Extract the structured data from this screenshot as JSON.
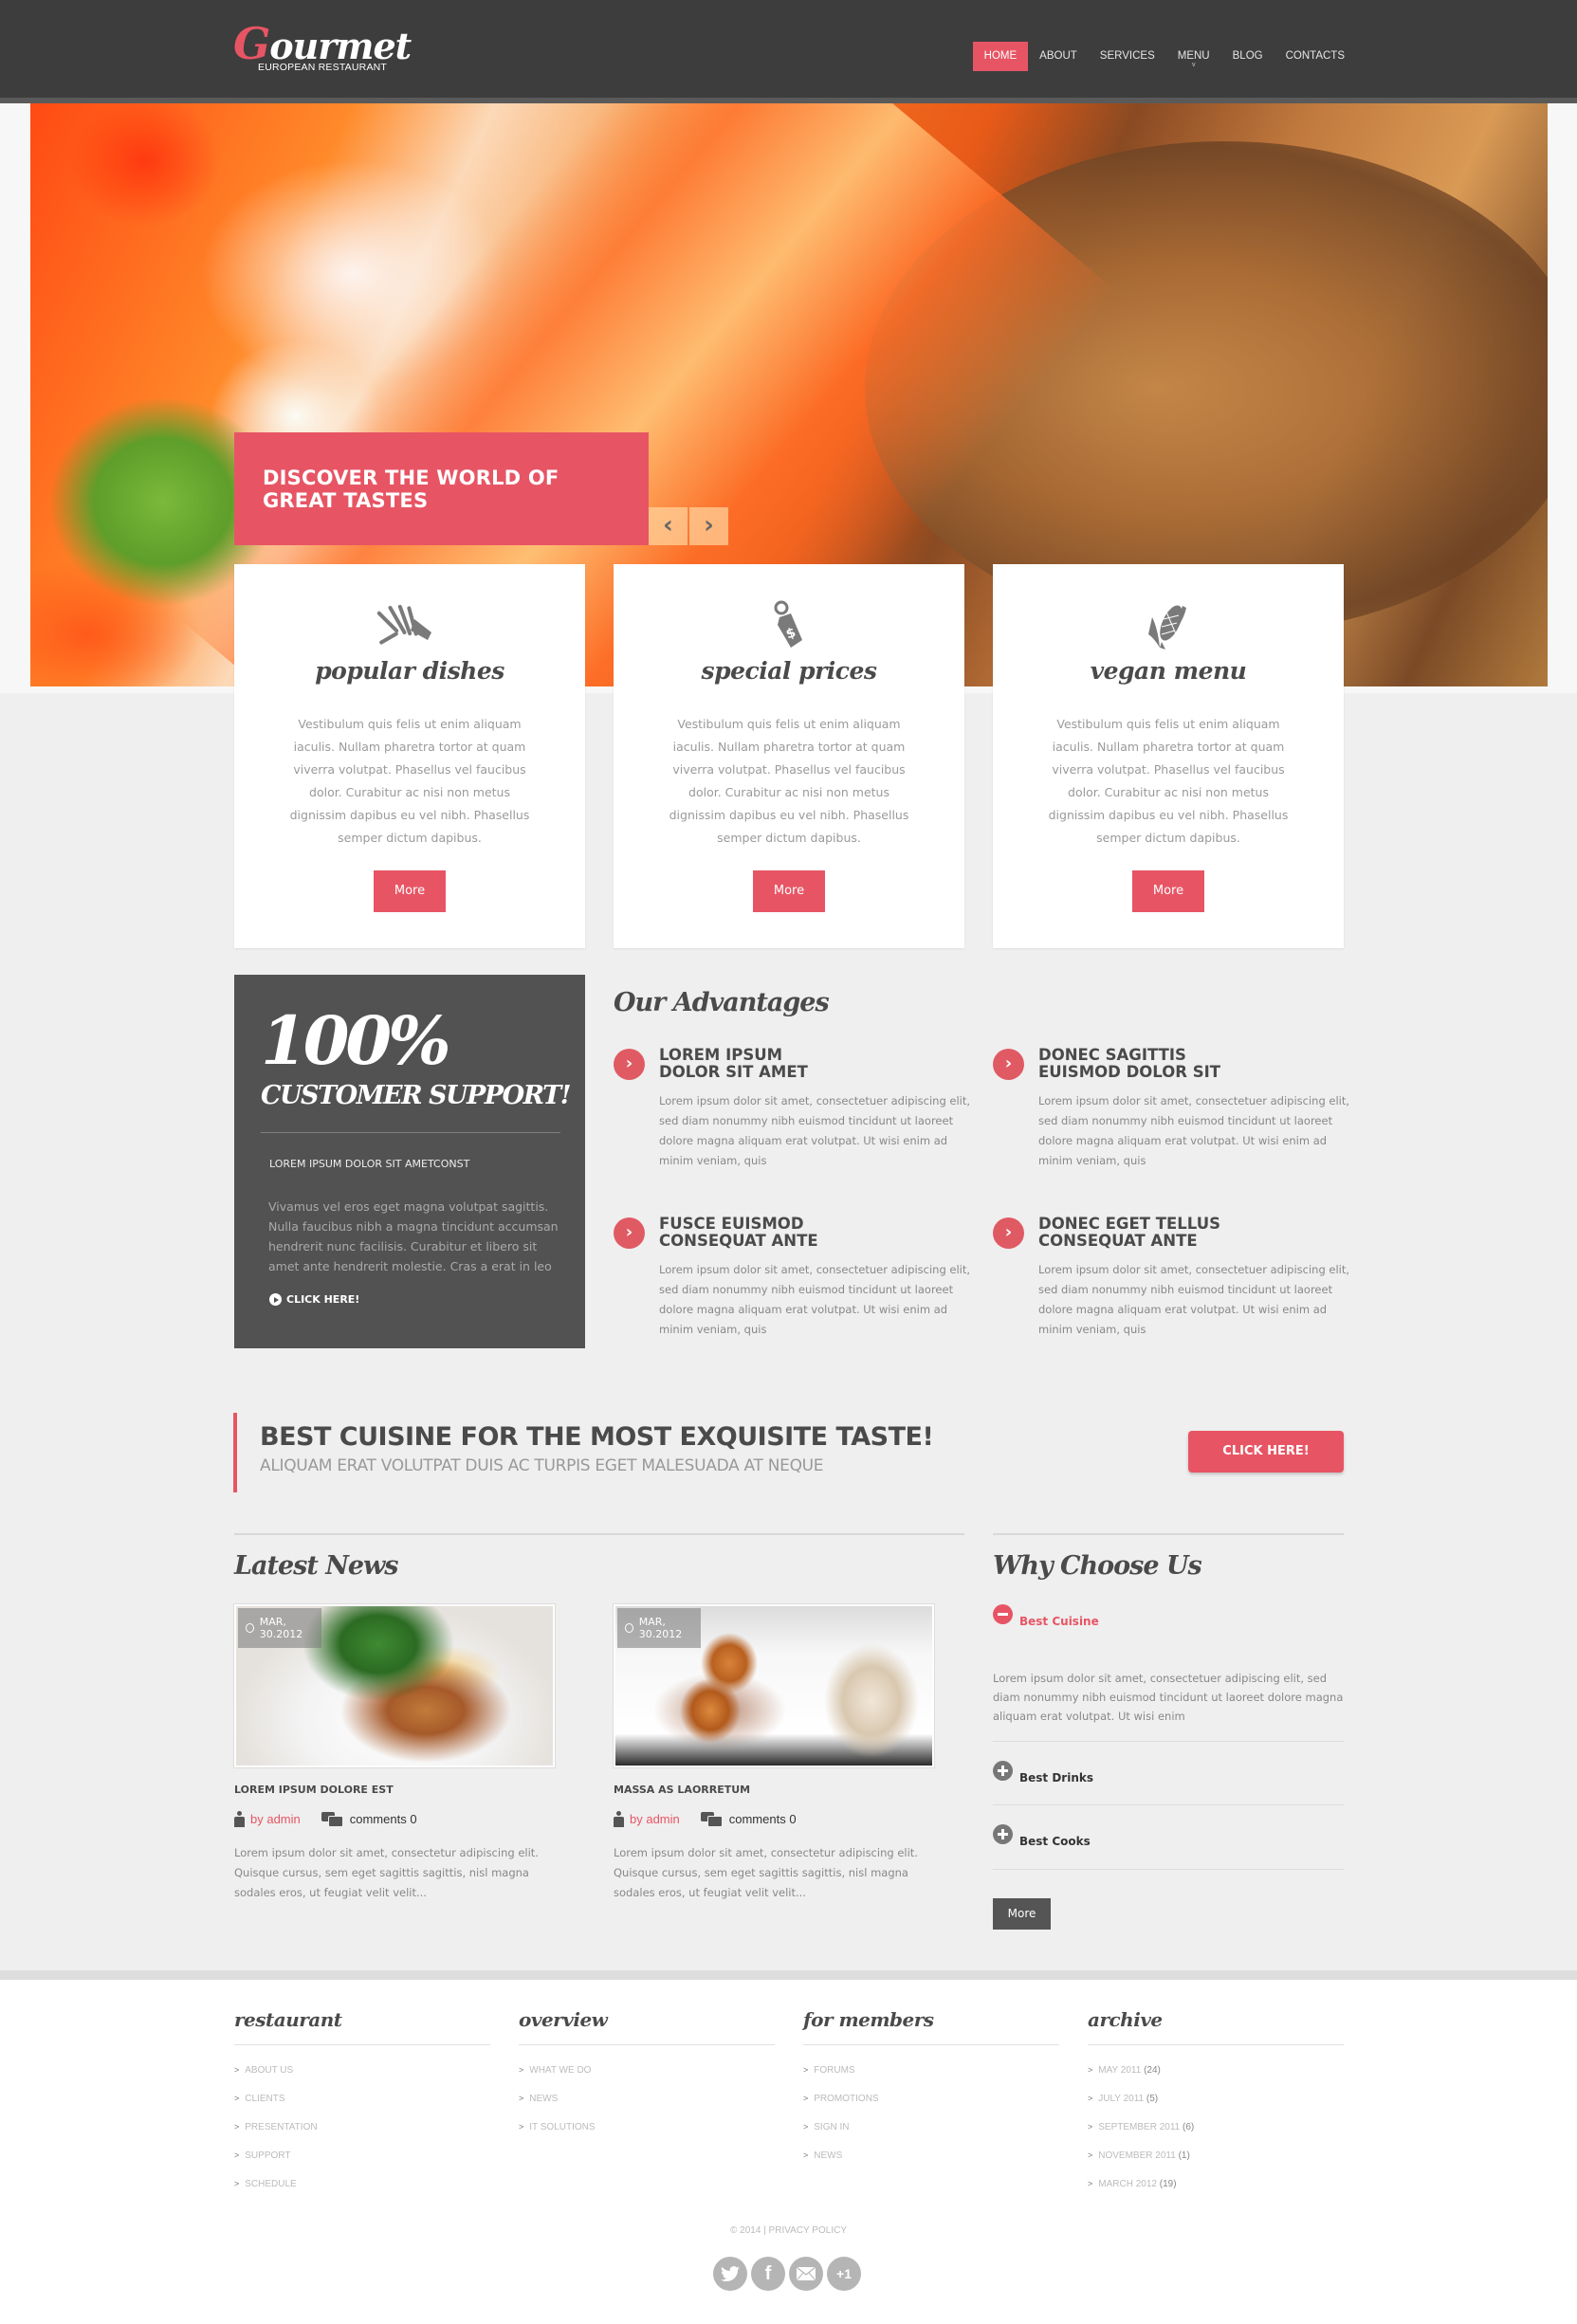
{
  "brand": {
    "logo_initial": "G",
    "logo_rest": "ourmet",
    "tagline": "EUROPEAN RESTAURANT",
    "accent": "#e75564",
    "dark": "#3d3d3d"
  },
  "nav": {
    "items": [
      {
        "label": "HOME",
        "active": true
      },
      {
        "label": "ABOUT"
      },
      {
        "label": "SERVICES"
      },
      {
        "label": "MENU",
        "has_submenu": true
      },
      {
        "label": "BLOG"
      },
      {
        "label": "CONTACTS"
      }
    ],
    "submenu_caret": "v"
  },
  "hero": {
    "caption": "DISCOVER THE WORLD OF GREAT TASTES",
    "prev_icon": "chevron-left-icon",
    "next_icon": "chevron-right-icon",
    "prev_glyph": "‹",
    "next_glyph": "›"
  },
  "features": [
    {
      "icon": "whisk-icon",
      "title": "popular dishes",
      "text": "Vestibulum quis felis ut enim aliquam iaculis. Nullam pharetra tortor at quam viverra volutpat. Phasellus vel faucibus dolor. Curabitur ac nisi non metus dignissim dapibus eu vel nibh. Phasellus semper dictum dapibus.",
      "button": "More"
    },
    {
      "icon": "price-tag-icon",
      "title": "special prices",
      "text": "Vestibulum quis felis ut enim aliquam iaculis. Nullam pharetra tortor at quam viverra volutpat. Phasellus vel faucibus dolor. Curabitur ac nisi non metus dignissim dapibus eu vel nibh. Phasellus semper dictum dapibus.",
      "button": "More"
    },
    {
      "icon": "corn-icon",
      "title": "vegan menu",
      "text": "Vestibulum quis felis ut enim aliquam iaculis. Nullam pharetra tortor at quam viverra volutpat. Phasellus vel faucibus dolor. Curabitur ac nisi non metus dignissim dapibus eu vel nibh. Phasellus semper dictum dapibus.",
      "button": "More"
    }
  ],
  "support": {
    "big": "100%",
    "sub": "CUSTOMER SUPPORT!",
    "label": "LOREM IPSUM DOLOR SIT AMETCONST",
    "text": "Vivamus vel eros eget magna volutpat sagittis. Nulla faucibus nibh a magna tincidunt accumsan hendrerit nunc facilisis. Curabitur et libero sit amet ante hendrerit molestie. Cras a erat in leo",
    "link": "CLICK HERE!"
  },
  "advantages": {
    "title": "Our Advantages",
    "items": [
      {
        "title_line1": "LOREM IPSUM",
        "title_line2": "DOLOR SIT AMET",
        "text": "Lorem ipsum dolor sit amet, consectetuer adipiscing elit, sed diam nonummy nibh euismod tincidunt ut laoreet dolore magna aliquam erat volutpat. Ut wisi enim ad minim veniam, quis"
      },
      {
        "title_line1": "DONEC SAGITTIS",
        "title_line2": "EUISMOD DOLOR SIT",
        "text": "Lorem ipsum dolor sit amet, consectetuer adipiscing elit, sed diam nonummy nibh euismod tincidunt ut laoreet dolore magna aliquam erat volutpat. Ut wisi enim ad minim veniam, quis"
      },
      {
        "title_line1": "FUSCE EUISMOD",
        "title_line2": "CONSEQUAT ANTE",
        "text": "Lorem ipsum dolor sit amet, consectetuer adipiscing elit, sed diam nonummy nibh euismod tincidunt ut laoreet dolore magna aliquam erat volutpat. Ut wisi enim ad minim veniam, quis"
      },
      {
        "title_line1": "DONEC EGET TELLUS",
        "title_line2": "CONSEQUAT ANTE",
        "text": "Lorem ipsum dolor sit amet, consectetuer adipiscing elit, sed diam nonummy nibh euismod tincidunt ut laoreet dolore magna aliquam erat volutpat. Ut wisi enim ad minim veniam, quis"
      }
    ],
    "arrow_glyph": "›"
  },
  "cta": {
    "title": "BEST CUISINE FOR THE MOST EXQUISITE TASTE!",
    "subtitle": "ALIQUAM ERAT VOLUTPAT DUIS AC TURPIS EGET MALESUADA AT NEQUE",
    "button": "CLICK HERE!"
  },
  "news": {
    "title": "Latest News",
    "items": [
      {
        "date": "MAR, 30.2012",
        "title": "LOREM IPSUM DOLORE EST",
        "author": "by admin",
        "comments": "comments 0",
        "text": "Lorem ipsum dolor sit amet, consectetur adipiscing elit. Quisque cursus, sem eget sagittis sagittis, nisl magna sodales eros, ut feugiat velit velit..."
      },
      {
        "date": "MAR, 30.2012",
        "title": "MASSA AS LAORRETUM",
        "author": "by admin",
        "comments": "comments 0",
        "text": "Lorem ipsum dolor sit amet, consectetur adipiscing elit. Quisque cursus, sem eget sagittis sagittis, nisl magna sodales eros, ut feugiat velit velit..."
      }
    ]
  },
  "why": {
    "title": "Why Choose Us",
    "items": [
      {
        "label": "Best Cuisine",
        "expanded": true,
        "text": "Lorem ipsum dolor sit amet, consectetuer adipiscing elit, sed diam nonummy nibh euismod tincidunt ut laoreet dolore magna aliquam erat volutpat. Ut wisi enim"
      },
      {
        "label": "Best Drinks",
        "expanded": false
      },
      {
        "label": "Best Cooks",
        "expanded": false
      }
    ],
    "button": "More"
  },
  "footer": {
    "columns": [
      {
        "title": "restaurant",
        "links": [
          {
            "label": "ABOUT US"
          },
          {
            "label": "CLIENTS"
          },
          {
            "label": "PRESENTATION"
          },
          {
            "label": "SUPPORT"
          },
          {
            "label": "SCHEDULE"
          }
        ]
      },
      {
        "title": "overview",
        "links": [
          {
            "label": "WHAT WE DO"
          },
          {
            "label": "NEWS"
          },
          {
            "label": "IT SOLUTIONS"
          }
        ]
      },
      {
        "title": "for members",
        "links": [
          {
            "label": "FORUMS"
          },
          {
            "label": "PROMOTIONS"
          },
          {
            "label": "SIGN IN"
          },
          {
            "label": "NEWS"
          }
        ]
      },
      {
        "title": "archive",
        "links": [
          {
            "label": "MAY 2011",
            "count": "(24)"
          },
          {
            "label": "JULY 2011",
            "count": "(5)"
          },
          {
            "label": "SEPTEMBER 2011",
            "count": "(6)"
          },
          {
            "label": "NOVEMBER 2011",
            "count": "(1)"
          },
          {
            "label": "MARCH 2012",
            "count": "(19)"
          }
        ]
      }
    ],
    "copyright": "© 2014 | PRIVACY POLICY",
    "link_chevron": ">",
    "social": [
      {
        "name": "twitter-icon",
        "glyph": "🐦"
      },
      {
        "name": "facebook-icon",
        "glyph": "f"
      },
      {
        "name": "email-icon",
        "glyph": ""
      },
      {
        "name": "google-plus-one-icon",
        "glyph": "+1"
      }
    ]
  }
}
